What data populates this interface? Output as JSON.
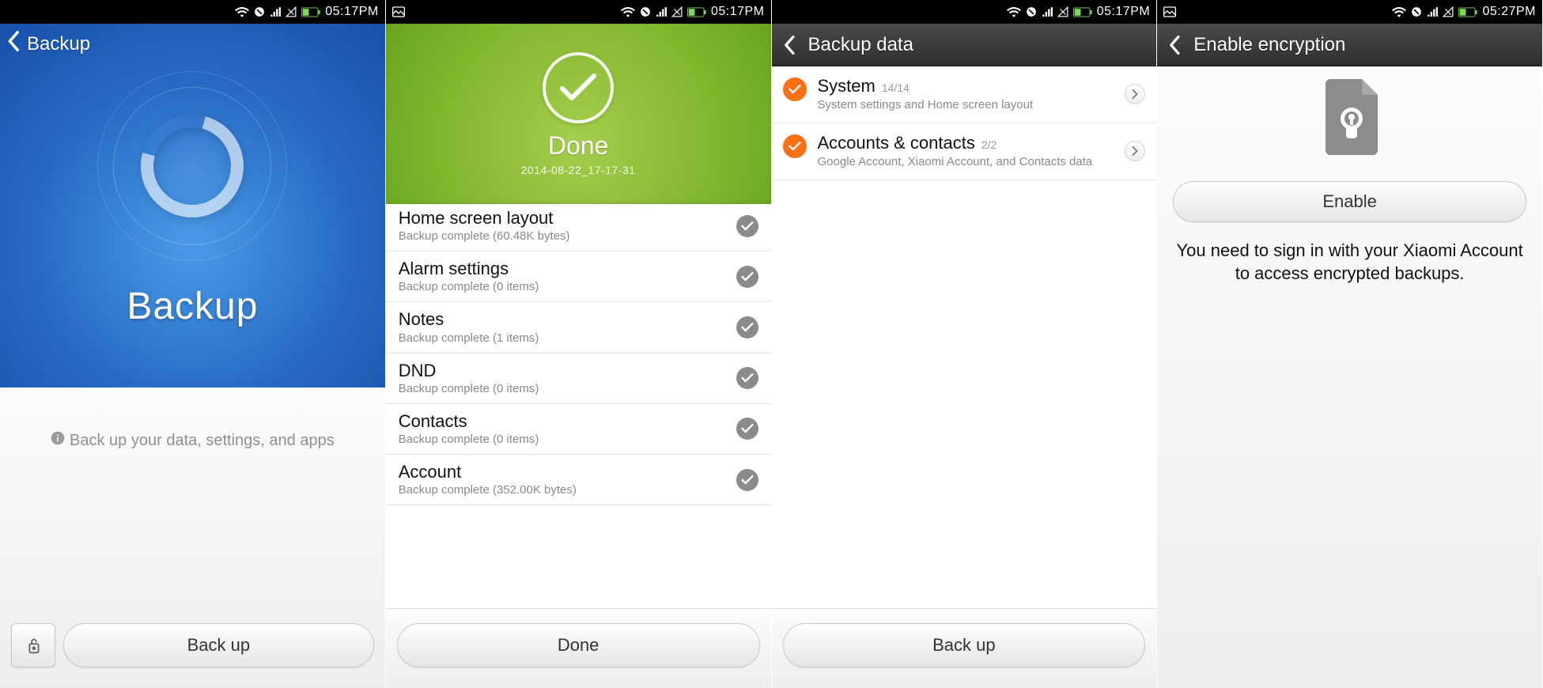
{
  "screen1": {
    "status_time": "05:17PM",
    "status_has_picture_icon": false,
    "header_title": "Backup",
    "hero_label": "Backup",
    "hint": "Back up your data, settings, and apps",
    "backup_btn": "Back up"
  },
  "screen2": {
    "status_time": "05:17PM",
    "done_title": "Done",
    "done_timestamp": "2014-08-22_17-17-31",
    "rows": [
      {
        "title": "Home screen layout",
        "sub": "Backup complete (60.48K  bytes)"
      },
      {
        "title": "Alarm settings",
        "sub": "Backup complete (0  items)"
      },
      {
        "title": "Notes",
        "sub": "Backup complete (1  items)"
      },
      {
        "title": "DND",
        "sub": "Backup complete (0  items)"
      },
      {
        "title": "Contacts",
        "sub": "Backup complete (0  items)"
      },
      {
        "title": "Account",
        "sub": "Backup complete (352.00K  bytes)"
      }
    ],
    "done_btn": "Done"
  },
  "screen3": {
    "status_time": "05:17PM",
    "header_title": "Backup data",
    "items": [
      {
        "title": "System",
        "count": "14/14",
        "sub": "System settings and Home screen layout"
      },
      {
        "title": "Accounts & contacts",
        "count": "2/2",
        "sub": "Google Account, Xiaomi Account, and Contacts data"
      }
    ],
    "backup_btn": "Back up"
  },
  "screen4": {
    "status_time": "05:27PM",
    "header_title": "Enable encryption",
    "enable_btn": "Enable",
    "message": "You need to sign in with your Xiaomi Account to access encrypted backups."
  }
}
